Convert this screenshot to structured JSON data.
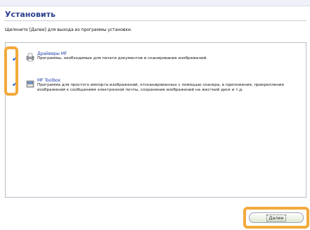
{
  "header": {
    "title": "Установить",
    "instruction": "Щелкните [Далее] для выхода из программы установки."
  },
  "items": [
    {
      "name": "Драйверы MF",
      "description": "Программы, необходимые для печати документов и сканирования изображений.",
      "checked": true,
      "icon": "printer-driver-icon"
    },
    {
      "name": "MF Toolbox",
      "description": "Программа для простого импорта изображений, отсканированных с помощью сканера, в приложения, прикрепления изображений к сообщениям электронной почты, сохранения изображений на жесткий диск и т.д.",
      "checked": true,
      "icon": "toolbox-icon"
    }
  ],
  "footer": {
    "next_label": "Далее"
  },
  "colors": {
    "title": "#2a3f8f",
    "link": "#1d3aa8",
    "check": "#1e5bd6",
    "highlight": "#f2a93b"
  }
}
